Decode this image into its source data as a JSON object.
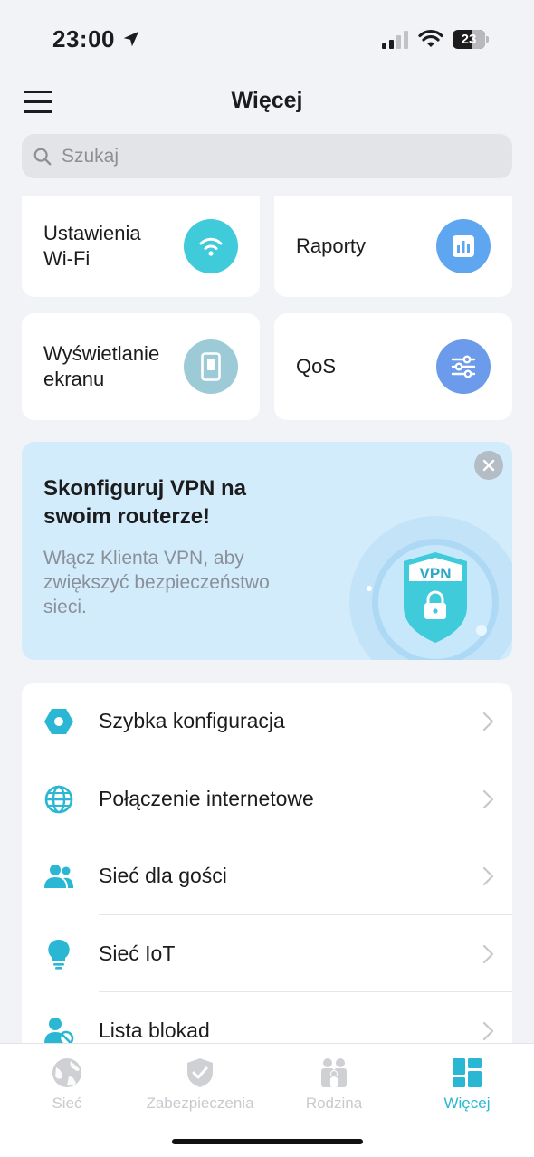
{
  "status_bar": {
    "time": "23:00",
    "battery": "23"
  },
  "header": {
    "title": "Więcej"
  },
  "search": {
    "placeholder": "Szukaj"
  },
  "tiles": [
    {
      "label": "Ustawienia Wi-Fi",
      "icon": "wifi-icon",
      "color": "#3fcbd9"
    },
    {
      "label": "Raporty",
      "icon": "bar-chart-icon",
      "color": "#5fa6f0"
    },
    {
      "label": "Wyświetlanie ekranu",
      "icon": "display-icon",
      "color": "#9ccad6"
    },
    {
      "label": "QoS",
      "icon": "sliders-icon",
      "color": "#6b9bea"
    }
  ],
  "banner": {
    "title": "Skonfiguruj VPN na swoim routerze!",
    "text": "Włącz Klienta VPN, aby zwiększyć bezpieczeństwo sieci.",
    "badge": "VPN"
  },
  "menu": [
    {
      "label": "Szybka konfiguracja",
      "icon": "hexagon-icon"
    },
    {
      "label": "Połączenie internetowe",
      "icon": "globe-icon"
    },
    {
      "label": "Sieć dla gości",
      "icon": "guests-icon"
    },
    {
      "label": "Sieć IoT",
      "icon": "lightbulb-icon"
    },
    {
      "label": "Lista blokad",
      "icon": "blocked-user-icon"
    }
  ],
  "tabbar": [
    {
      "label": "Sieć",
      "icon": "network-globe-icon",
      "active": false
    },
    {
      "label": "Zabezpieczenia",
      "icon": "shield-check-icon",
      "active": false
    },
    {
      "label": "Rodzina",
      "icon": "family-icon",
      "active": false
    },
    {
      "label": "Więcej",
      "icon": "grid-icon",
      "active": true
    }
  ],
  "colors": {
    "accent": "#2ab7d3",
    "background": "#f2f3f7",
    "banner": "#d3ecfb"
  }
}
